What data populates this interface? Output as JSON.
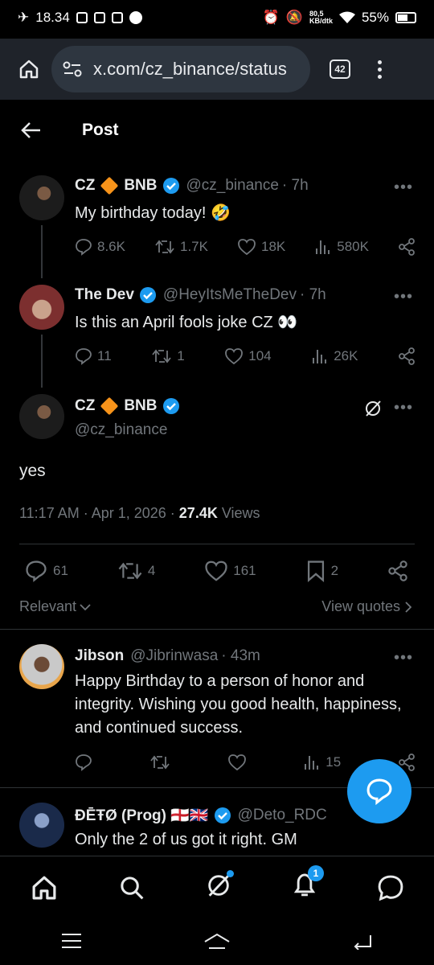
{
  "statusbar": {
    "time": "18.34",
    "net_speed": "80,5\nKB/dtk",
    "battery": "55%"
  },
  "browser": {
    "url": "x.com/cz_binance/status",
    "tab_count": "42"
  },
  "header": {
    "title": "Post"
  },
  "tweet1": {
    "name_pre": "CZ",
    "name_post": "BNB",
    "handle": "@cz_binance",
    "time": "· 7h",
    "text": "My birthday today! 🤣",
    "replies": "8.6K",
    "reposts": "1.7K",
    "likes": "18K",
    "views": "580K"
  },
  "tweet2": {
    "name": "The Dev",
    "handle": "@HeyItsMeTheDev",
    "time": "· 7h",
    "text": "Is this an April fools joke CZ 👀",
    "replies": "11",
    "reposts": "1",
    "likes": "104",
    "views": "26K"
  },
  "main": {
    "name_pre": "CZ",
    "name_post": "BNB",
    "handle": "@cz_binance",
    "text": "yes",
    "timestamp": "11:17 AM · Apr 1, 2026 · ",
    "views_count": "27.4K",
    "views_label": "Views",
    "replies": "61",
    "reposts": "4",
    "likes": "161",
    "bookmarks": "2",
    "sort_label": "Relevant",
    "view_quotes": "View quotes"
  },
  "reply1": {
    "name": "Jibson",
    "handle": "@Jibrinwasa",
    "time": "· 43m",
    "text": "Happy Birthday to a person of honor and integrity. Wishing you good health, happiness, and continued success.",
    "views": "15"
  },
  "reply2": {
    "name": "ĐĒŦØ (Prog) 🏴󠁧󠁢󠁥󠁮󠁧󠁿🇬🇧",
    "handle": "@Deto_RDC",
    "text": "Only the 2 of us got it right. GM"
  },
  "nav": {
    "notif_badge": "1"
  },
  "colors": {
    "accent": "#1d9bf0",
    "bg": "#000000",
    "muted": "#71767b",
    "bnb": "#f7931a"
  }
}
